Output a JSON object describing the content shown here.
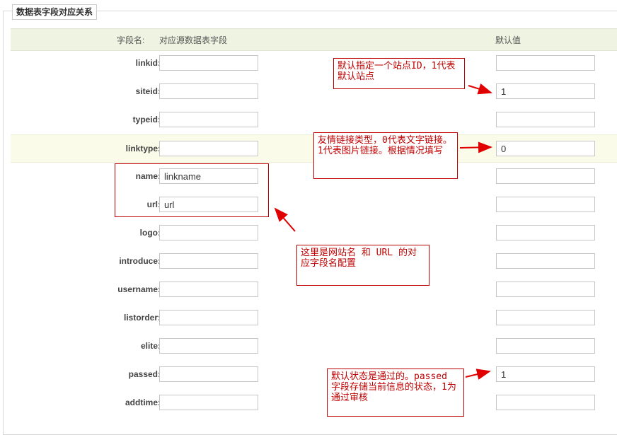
{
  "section": {
    "title": "数据表字段对应关系"
  },
  "header": {
    "field_name": "字段名:",
    "source_field": "对应源数据表字段",
    "default_value": "默认值"
  },
  "fields": [
    {
      "label": "linkid:",
      "source": "",
      "default": ""
    },
    {
      "label": "siteid:",
      "source": "",
      "default": "1"
    },
    {
      "label": "typeid:",
      "source": "",
      "default": ""
    },
    {
      "label": "linktype:",
      "source": "",
      "default": "0"
    },
    {
      "label": "name:",
      "source": "linkname",
      "default": ""
    },
    {
      "label": "url:",
      "source": "url",
      "default": ""
    },
    {
      "label": "logo:",
      "source": "",
      "default": ""
    },
    {
      "label": "introduce:",
      "source": "",
      "default": ""
    },
    {
      "label": "username:",
      "source": "",
      "default": ""
    },
    {
      "label": "listorder:",
      "source": "",
      "default": ""
    },
    {
      "label": "elite:",
      "source": "",
      "default": ""
    },
    {
      "label": "passed:",
      "source": "",
      "default": "1"
    },
    {
      "label": "addtime:",
      "source": "",
      "default": ""
    }
  ],
  "annotations": {
    "siteid_note": "默认指定一个站点ID，1代表默认站点",
    "linktype_note": "友情链接类型，0代表文字链接。1代表图片链接。根据情况填写",
    "name_url_note": "这里是网站名 和 URL 的对应字段名配置",
    "passed_note": "默认状态是通过的。passed 字段存储当前信息的状态，1为通过审核"
  },
  "colors": {
    "annotation": "#c00000",
    "header_bg": "#eef3e2",
    "highlight_row": "#fafce9"
  }
}
